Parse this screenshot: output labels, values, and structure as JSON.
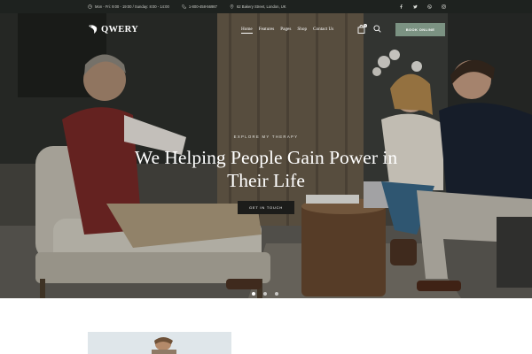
{
  "topbar": {
    "hours": "Mon - Fri: 9:00 - 19:00  /  Sunday: 8:00 - 14:00",
    "phone": "1-800-458-56987",
    "address": "62 Bakery Street, London, UK",
    "social_icons": [
      "facebook-icon",
      "twitter-icon",
      "dribbble-icon",
      "instagram-icon"
    ]
  },
  "nav": {
    "logo_text": "QWERY",
    "menu": [
      "Home",
      "Features",
      "Pages",
      "Shop",
      "Contact Us"
    ],
    "active_item": "Home",
    "cart_count": "0",
    "book_button": "BOOK ONLINE"
  },
  "hero": {
    "kicker": "EXPLORE MY THERAPY",
    "headline": "We Helping People Gain Power in Their Life",
    "cta": "GET IN TOUCH",
    "slides": 3,
    "active_slide": 1
  },
  "colors": {
    "topbar_bg": "#1e221f",
    "accent": "#7b9282",
    "cta_bg": "#1c1c1a",
    "text_light": "#ffffff"
  }
}
